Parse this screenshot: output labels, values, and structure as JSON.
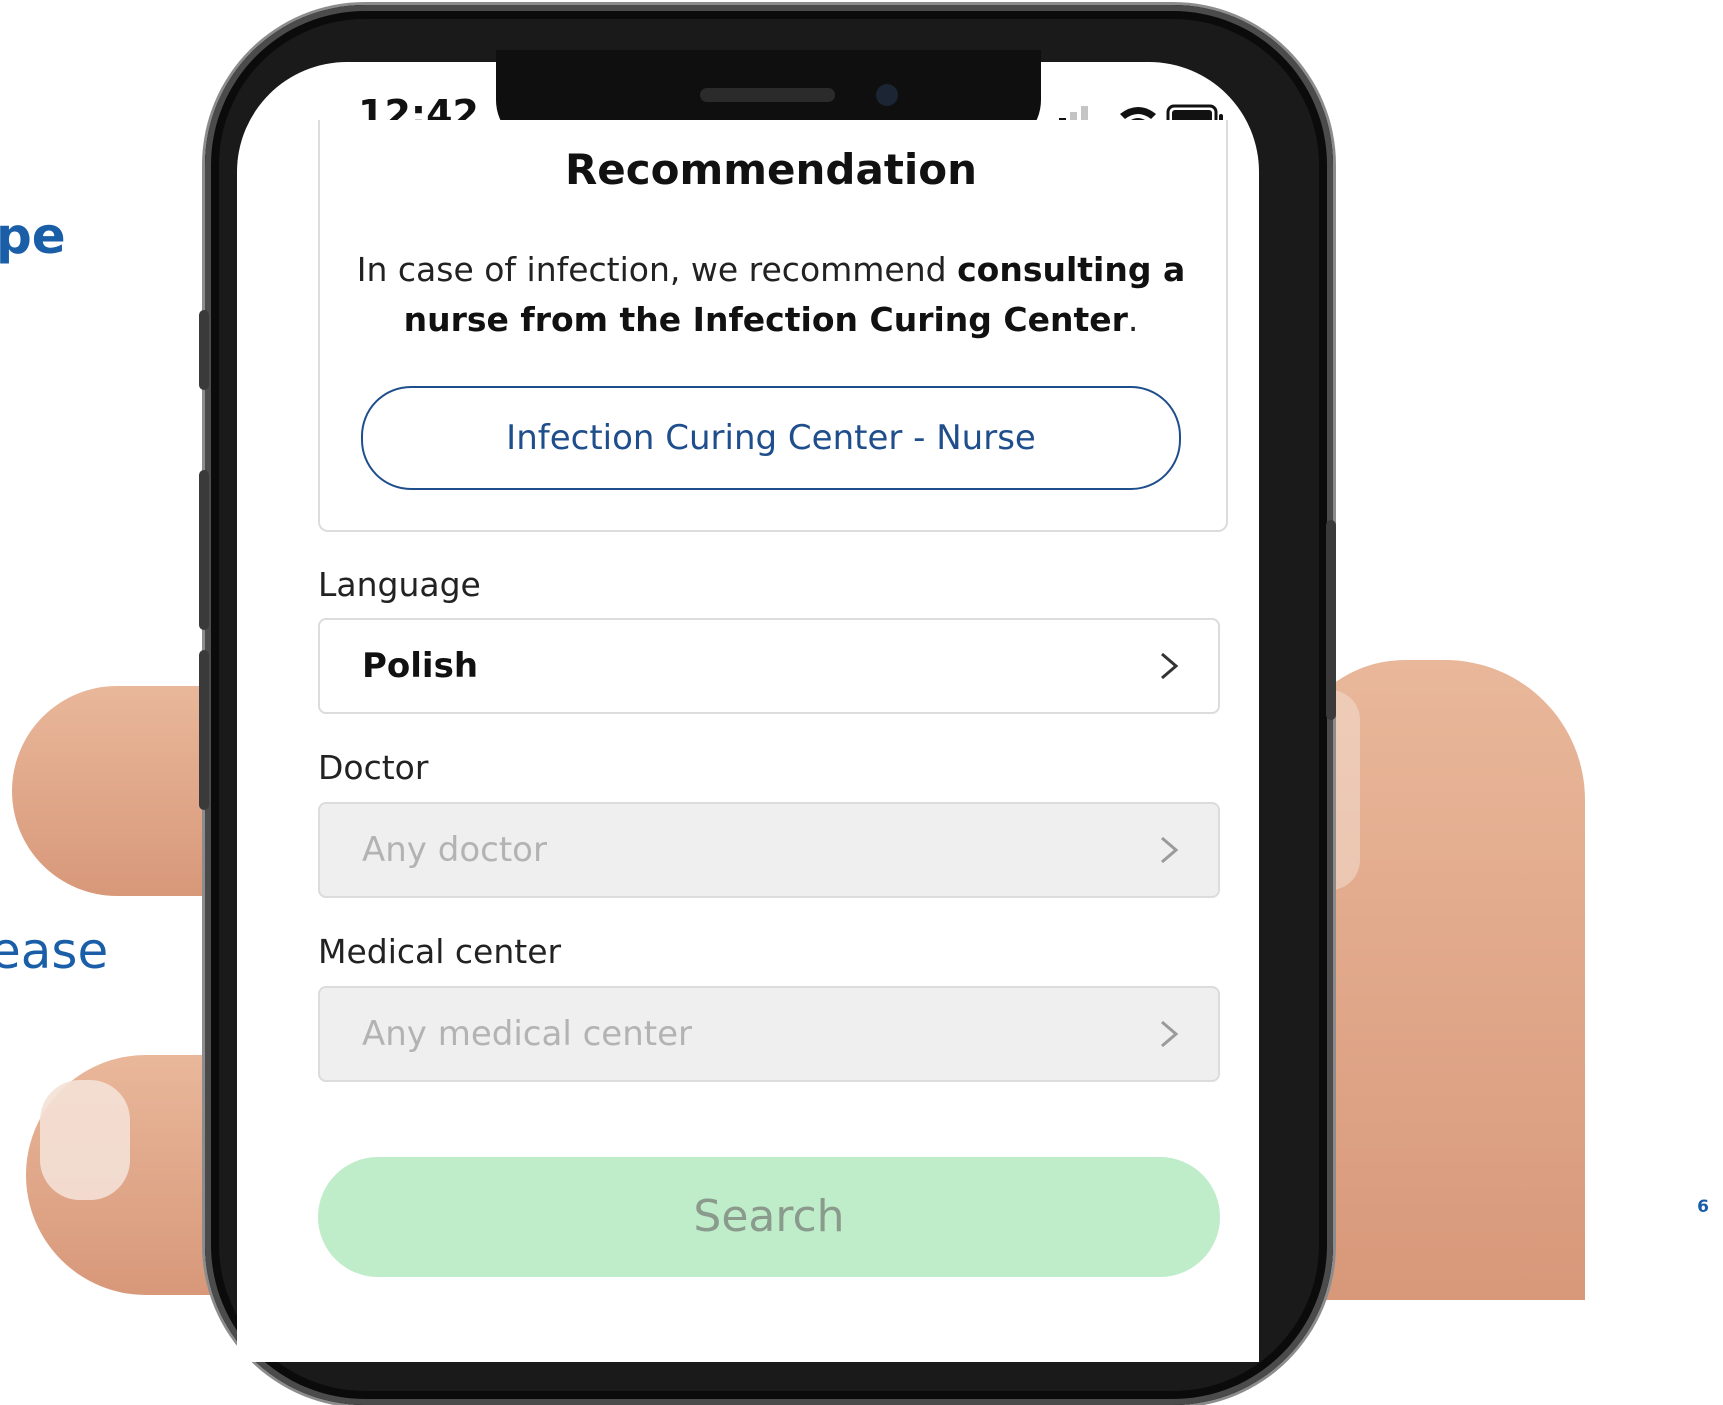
{
  "slide": {
    "fragment_1": "pe",
    "fragment_2": "ease",
    "page_number": "6"
  },
  "status_bar": {
    "time": "12:42",
    "icons": [
      "signal-icon",
      "wifi-icon",
      "battery-icon"
    ]
  },
  "recommendation": {
    "title": "Recommendation",
    "text_plain": "In case of infection, we recommend ",
    "text_bold": "consulting a nurse from the Infection Curing Center",
    "text_end": ".",
    "button_label": "Infection Curing Center - Nurse"
  },
  "form": {
    "language": {
      "label": "Language",
      "value": "Polish"
    },
    "doctor": {
      "label": "Doctor",
      "placeholder": "Any doctor"
    },
    "medical_center": {
      "label": "Medical center",
      "placeholder": "Any medical center"
    },
    "search_label": "Search"
  },
  "colors": {
    "accent_blue": "#1f4e8c",
    "slide_blue": "#1a5ea8",
    "search_green": "#bfecc9"
  }
}
